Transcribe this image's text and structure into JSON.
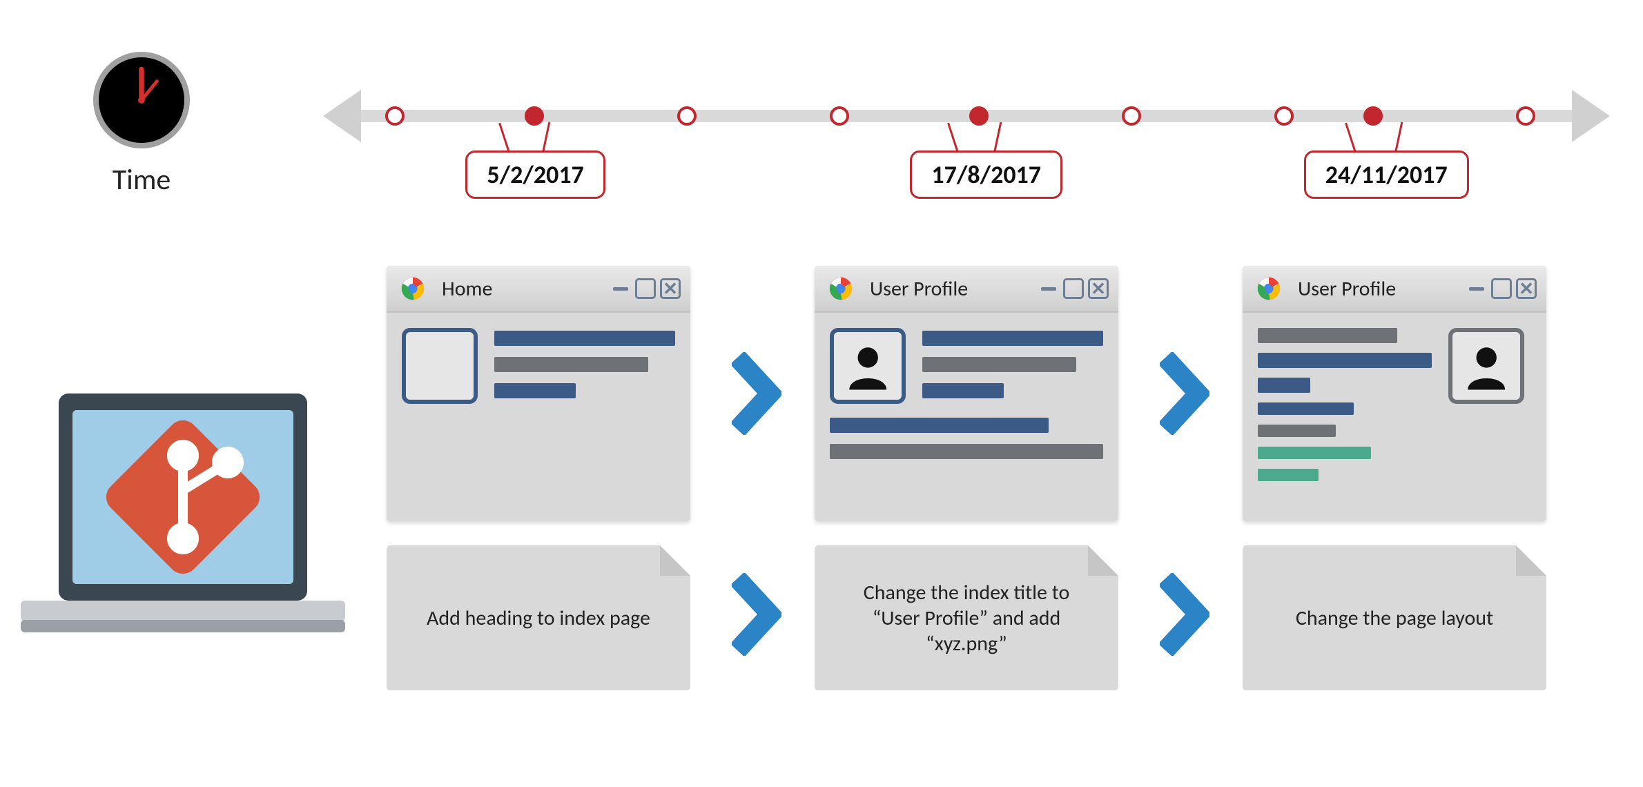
{
  "time_label": "Time",
  "timeline": {
    "ticks": [
      {
        "pos_pct": 5,
        "filled": false
      },
      {
        "pos_pct": 16,
        "filled": true,
        "date": "5/2/2017"
      },
      {
        "pos_pct": 28,
        "filled": false
      },
      {
        "pos_pct": 40,
        "filled": false
      },
      {
        "pos_pct": 51,
        "filled": true,
        "date": "17/8/2017"
      },
      {
        "pos_pct": 63,
        "filled": false
      },
      {
        "pos_pct": 75,
        "filled": false
      },
      {
        "pos_pct": 82,
        "filled": true,
        "date": "24/11/2017"
      },
      {
        "pos_pct": 94,
        "filled": false
      }
    ]
  },
  "stages": [
    {
      "window_title": "Home",
      "commit_message": "Add heading to index page"
    },
    {
      "window_title": "User Profile",
      "commit_message": "Change the index title to “User Profile” and add “xyz.png”"
    },
    {
      "window_title": "User Profile",
      "commit_message": "Change the page layout"
    }
  ],
  "icons": {
    "clock": "clock-icon",
    "browser": "chrome-icon",
    "vcs": "git-icon"
  }
}
